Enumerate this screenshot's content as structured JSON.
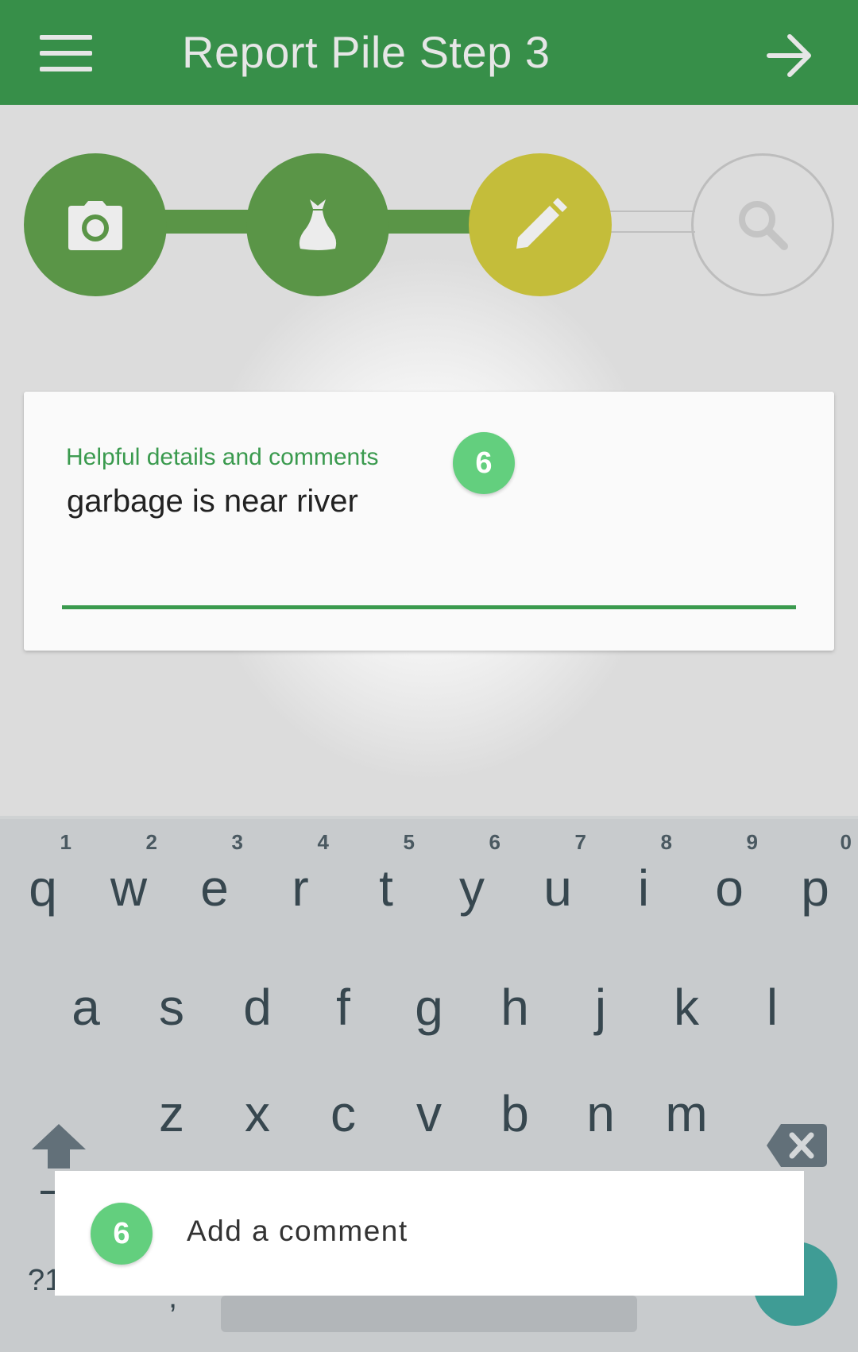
{
  "app_bar": {
    "title": "Report Pile Step 3",
    "menu_icon": "hamburger-menu-icon",
    "next_icon": "arrow-forward-icon",
    "background": "#378f49"
  },
  "stepper": {
    "steps": [
      {
        "icon": "camera-icon",
        "state": "done"
      },
      {
        "icon": "garbage-bag-icon",
        "state": "done"
      },
      {
        "icon": "pencil-icon",
        "state": "current"
      },
      {
        "icon": "search-icon",
        "state": "pending"
      }
    ],
    "colors": {
      "done": "#5a9547",
      "current": "#c4bd3a",
      "pending": "#bdbdbd"
    }
  },
  "comment_card": {
    "label": "Helpful details and comments",
    "value": "garbage is near river",
    "badge": "6"
  },
  "keyboard": {
    "row1": [
      {
        "char": "q",
        "hint": "1"
      },
      {
        "char": "w",
        "hint": "2"
      },
      {
        "char": "e",
        "hint": "3"
      },
      {
        "char": "r",
        "hint": "4"
      },
      {
        "char": "t",
        "hint": "5"
      },
      {
        "char": "y",
        "hint": "6"
      },
      {
        "char": "u",
        "hint": "7"
      },
      {
        "char": "i",
        "hint": "8"
      },
      {
        "char": "o",
        "hint": "9"
      },
      {
        "char": "p",
        "hint": "0"
      }
    ],
    "row2": [
      "a",
      "s",
      "d",
      "f",
      "g",
      "h",
      "j",
      "k",
      "l"
    ],
    "row3": [
      "z",
      "x",
      "c",
      "v",
      "b",
      "n",
      "m"
    ],
    "symbols_label": "?1",
    "comma_label": ","
  },
  "tutorial_tooltip": {
    "badge": "6",
    "text": "Add a comment"
  }
}
